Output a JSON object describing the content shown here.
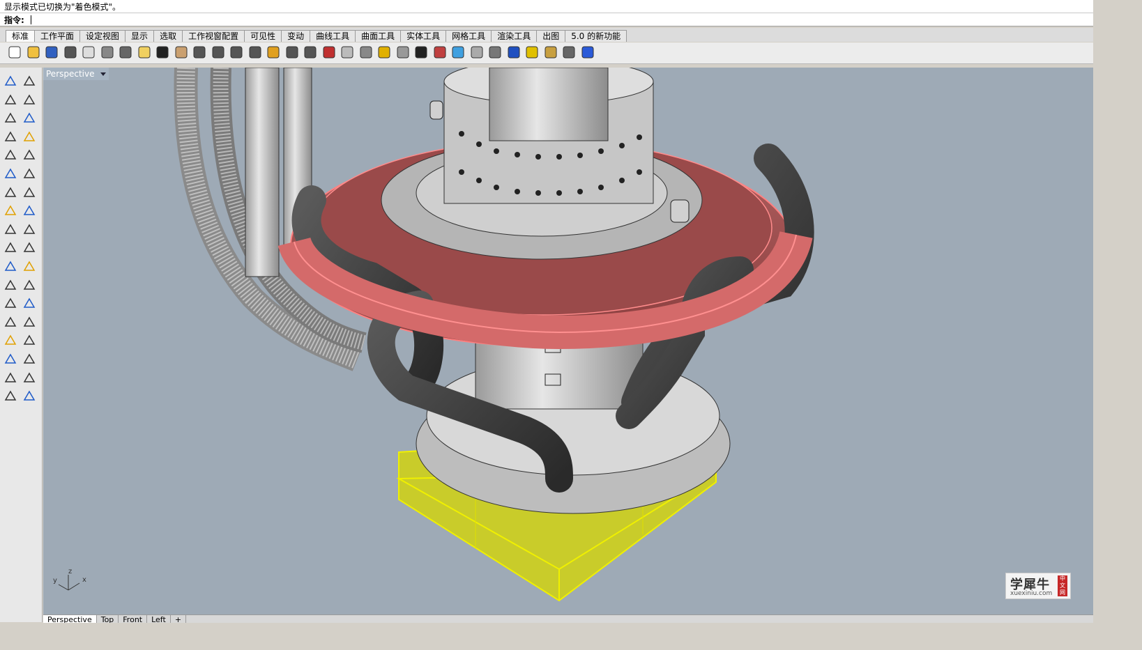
{
  "history": {
    "last_message": "显示模式已切换为\"着色模式\"。"
  },
  "command": {
    "label": "指令:"
  },
  "tabs": [
    "标准",
    "工作平面",
    "设定视图",
    "显示",
    "选取",
    "工作视窗配置",
    "可见性",
    "变动",
    "曲线工具",
    "曲面工具",
    "实体工具",
    "网格工具",
    "渲染工具",
    "出图",
    "5.0 的新功能"
  ],
  "toolbar_icons": [
    "new-file-icon",
    "open-folder-icon",
    "save-icon",
    "print-icon",
    "import-icon",
    "cut-icon",
    "copy-icon",
    "paste-icon",
    "undo-icon",
    "pan-hand-icon",
    "rotate-view-icon",
    "zoom-window-icon",
    "zoom-dynamic-icon",
    "zoom-extents-icon",
    "zoom-selected-icon",
    "rotate-camera-icon",
    "four-viewports-icon",
    "car-icon",
    "plane-icon",
    "circle-object-icon",
    "points-icon",
    "lightbulb-icon",
    "lock-icon",
    "layer-icon",
    "color-wheel-icon",
    "shaded-sphere-icon",
    "rendered-sphere-icon",
    "blue-sphere-icon",
    "filter-icon",
    "settings-gear-icon",
    "dimension-icon",
    "help-icon"
  ],
  "viewport": {
    "name": "Perspective",
    "background": "#9eaab6",
    "axes": {
      "x": "x",
      "y": "y",
      "z": "z"
    }
  },
  "viewport_tabs": [
    "Perspective",
    "Top",
    "Front",
    "Left",
    "+"
  ],
  "watermark": {
    "title": "学犀牛",
    "url": "xuexiniu.com",
    "seal": "中文网"
  },
  "colors": {
    "selection_yellow": "#e4e800",
    "selection_red": "#e87070",
    "pipe_dark": "#444444",
    "metal": "#c8c8c8"
  }
}
